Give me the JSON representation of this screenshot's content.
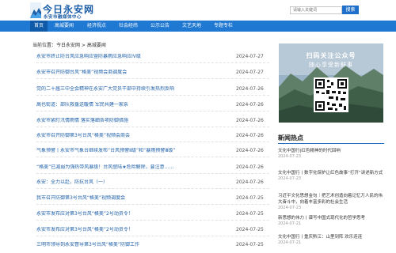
{
  "header": {
    "logo_title": "今日永安网",
    "logo_subtitle": "永安市融媒体中心",
    "search_placeholder": "请输入关键词",
    "search_button": "搜索"
  },
  "nav": {
    "items": [
      {
        "label": "首页",
        "active": true
      },
      {
        "label": "高城要闻",
        "active": false
      },
      {
        "label": "经济视点",
        "active": false
      },
      {
        "label": "社会经纬",
        "active": false
      },
      {
        "label": "公示公告",
        "active": false
      },
      {
        "label": "文艺天地",
        "active": false
      },
      {
        "label": "专题专栏",
        "active": false
      }
    ]
  },
  "breadcrumb": "当前位置：今日永安网 > 高城要闻",
  "news": [
    {
      "title": "永安市终止防台风应急响应暨防暴雨应急响应IV级",
      "date": "2024-07-27"
    },
    {
      "title": "永安市召开防御台风“格美”视频会商调度会",
      "date": "2024-07-27"
    },
    {
      "title": "党的二十届三中全会精神在永安广大党员干部中持续引发热烈反响",
      "date": "2024-07-26"
    },
    {
      "title": "高也街道：部队救援送暖情 军民共建一家亲",
      "date": "2024-07-26"
    },
    {
      "title": "永安市紧盯汛情雨情 落实落细各项防御措施",
      "date": "2024-07-26"
    },
    {
      "title": "永安市召开防御第3号台风“格美”视频会商会",
      "date": "2024-07-26"
    },
    {
      "title": "气象预警丨永安市气象台继续发布“台风预警Ⅱ级”和“暴雨预警Ⅲ级”",
      "date": "2024-07-26"
    },
    {
      "title": "“格美”已减弱为强热带风暴级！台风登陆★危险解除，要注意……",
      "date": "2024-07-26"
    },
    {
      "title": "永安：全力以赴，防抗台风（一）",
      "date": "2024-07-26"
    },
    {
      "title": "我市召开防御第3号台风“格美”视频调度会",
      "date": "2024-07-25"
    },
    {
      "title": "永安市发布应对第3号台风“格美”2号动员令！",
      "date": "2024-07-25"
    },
    {
      "title": "永安市发布应对第3号台风“格美”2号动员令！",
      "date": "2024-07-25"
    },
    {
      "title": "三明市领导到永安督导第3号台风“格美”防御工作",
      "date": "2024-07-25"
    }
  ],
  "sidebar": {
    "qr_line1": "扫码关注公众号",
    "qr_line2": "随心享受新鲜事",
    "hot_title": "新闻热点",
    "hot_items": [
      {
        "text": "文化中国行|红色精神的时代回响",
        "date": "2024-07-23"
      },
      {
        "text": "文化中国行丨数字化保护让红色故事“打开”讲述新方式",
        "date": "2024-07-23"
      },
      {
        "text": "习近平文化思想金句｜把艺术创造向着记忆万人民的伟大奋斗中，向着丰富多彩的社会生活",
        "date": "2024-07-23"
      },
      {
        "text": "新思想的伟力丨谱写中国式现代化的哲学思考",
        "date": "2024-07-21"
      },
      {
        "text": "文化中国行丨重庆黔江：山里到阵 欢乐连连",
        "date": "2024-07-21"
      }
    ]
  },
  "colors": {
    "nav_bg": "#1f78d1",
    "nav_active": "#0f5aa9",
    "link": "#1d5fa8",
    "accent_rule": "#2a6fc0"
  }
}
